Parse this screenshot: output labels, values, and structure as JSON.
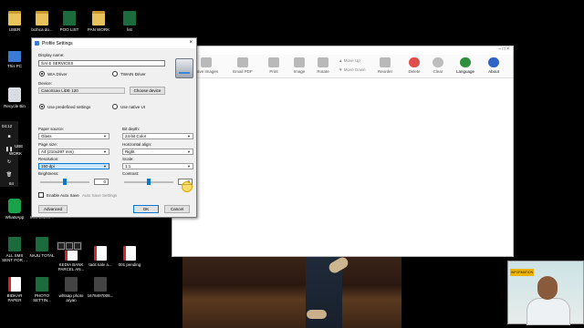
{
  "desktop": {
    "icons": [
      {
        "label": "USER",
        "kind": "folder"
      },
      {
        "label": "bcthca do...",
        "kind": "folder"
      },
      {
        "label": "POO LIST",
        "kind": "doc"
      },
      {
        "label": "PAN WORK",
        "kind": "folder"
      },
      {
        "label": "list",
        "kind": "doc"
      },
      {
        "label": "This PC",
        "kind": "pc"
      },
      {
        "label": "Recycle Bin",
        "kind": "bin"
      },
      {
        "label": "WhatsApp",
        "kind": "app"
      },
      {
        "label": "IMG 20200...",
        "kind": "img"
      },
      {
        "label": "ALL SMS SENT FOR ...",
        "kind": "doc"
      },
      {
        "label": "NAJU TOTAL",
        "kind": "doc"
      },
      {
        "label": "KEDIA BANK PARCEL AN...",
        "kind": "pdf"
      },
      {
        "label": "tacit nalv a...",
        "kind": "pdf"
      },
      {
        "label": "001 pending",
        "kind": "pdf"
      },
      {
        "label": "BIDKAR PAPER",
        "kind": "pdf"
      },
      {
        "label": "PHOTO SETTIN...",
        "kind": "doc"
      },
      {
        "label": "whtsap photo aryan",
        "kind": "dark"
      },
      {
        "label": "16784970​06...",
        "kind": "dark"
      }
    ],
    "side_labels": [
      "UBE",
      "WORK",
      "84"
    ]
  },
  "video": {
    "time": "04:12"
  },
  "main_window": {
    "toolbar": [
      {
        "label": "Save Images",
        "icon": "save-images-icon"
      },
      {
        "label": "Email PDF",
        "icon": "email-icon"
      },
      {
        "label": "Print",
        "icon": "print-icon"
      },
      {
        "label": "Image",
        "icon": "image-icon"
      },
      {
        "label": "Rotate",
        "icon": "rotate-icon"
      },
      {
        "label": "Reorder",
        "icon": "reorder-icon"
      },
      {
        "label": "Delete",
        "icon": "delete-icon"
      },
      {
        "label": "Clear",
        "icon": "clear-icon"
      },
      {
        "label": "Language",
        "icon": "globe-icon"
      },
      {
        "label": "About",
        "icon": "info-icon"
      }
    ],
    "move_up": "Move Up",
    "move_down": "Move Down",
    "window_controls": "–  □  ×"
  },
  "dialog": {
    "title": "Profile Settings",
    "close": "×",
    "display_name_label": "Display name:",
    "display_name_value": "SAI E SERVICES",
    "wia_label": "WIA Driver",
    "twain_label": "TWAIN Driver",
    "driver_selected": "WIA Driver",
    "device_label": "Device:",
    "device_value": "CanoScan LiDE 120",
    "choose_device": "Choose device",
    "use_predefined": "Use predefined settings",
    "use_native": "Use native UI",
    "paper_source_label": "Paper source:",
    "paper_source_value": "Glass",
    "bit_depth_label": "Bit depth:",
    "bit_depth_value": "24-bit Color",
    "page_size_label": "Page size:",
    "page_size_value": "A4 (210x297 mm)",
    "h_align_label": "Horizontal align:",
    "h_align_value": "Right",
    "resolution_label": "Resolution:",
    "resolution_value": "150 dpi",
    "scale_label": "Scale:",
    "scale_value": "1:1",
    "brightness_label": "Brightness:",
    "brightness_value": "0",
    "contrast_label": "Contrast:",
    "contrast_value": "0",
    "auto_save_label": "Enable Auto Save",
    "auto_save_settings": "Auto Save Settings",
    "advanced": "Advanced",
    "ok": "OK",
    "cancel": "Cancel"
  },
  "webcam": {
    "banner": "INFORMATION"
  }
}
